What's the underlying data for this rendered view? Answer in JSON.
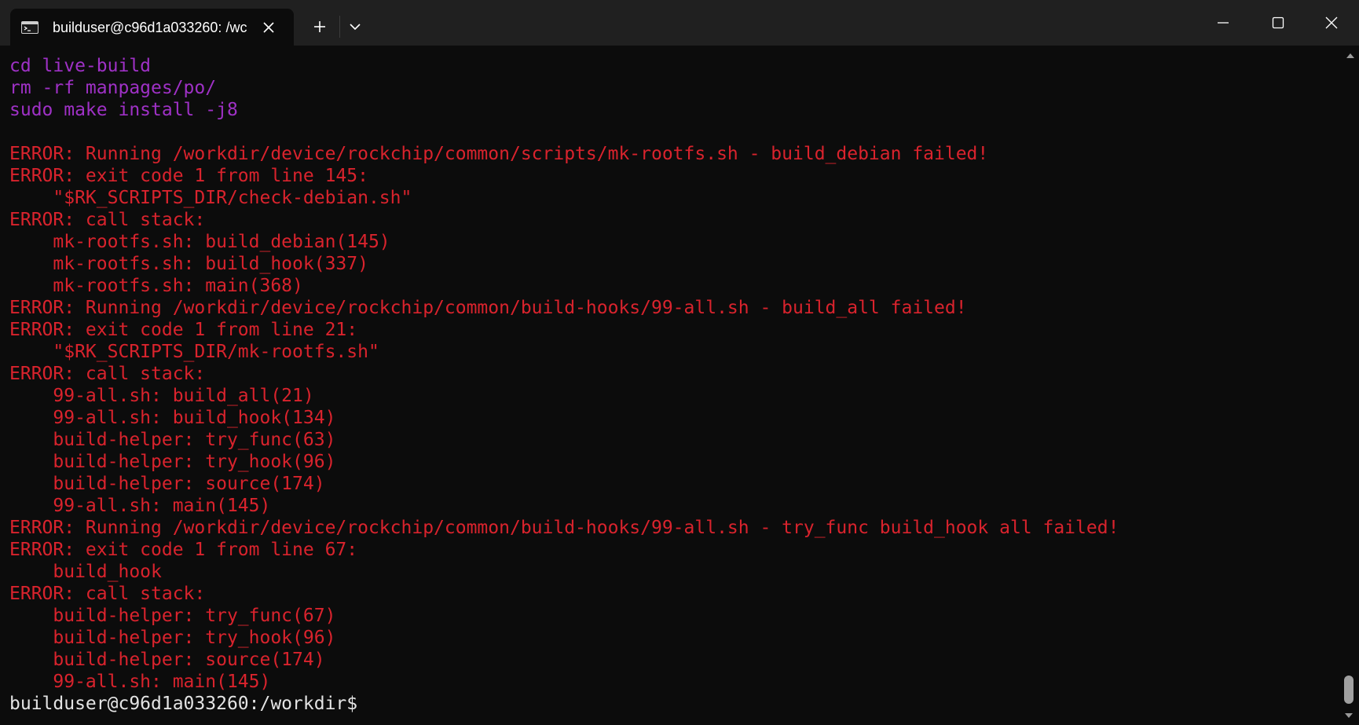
{
  "tab": {
    "title": "builduser@c96d1a033260: /wc"
  },
  "terminal": {
    "lines": [
      {
        "text": "cd live-build",
        "kind": "cmd"
      },
      {
        "text": "rm -rf manpages/po/",
        "kind": "cmd"
      },
      {
        "text": "sudo make install -j8",
        "kind": "cmd"
      },
      {
        "text": "",
        "kind": "blank"
      },
      {
        "text": "ERROR: Running /workdir/device/rockchip/common/scripts/mk-rootfs.sh - build_debian failed!",
        "kind": "err"
      },
      {
        "text": "ERROR: exit code 1 from line 145:",
        "kind": "err"
      },
      {
        "text": "    \"$RK_SCRIPTS_DIR/check-debian.sh\"",
        "kind": "err"
      },
      {
        "text": "ERROR: call stack:",
        "kind": "err"
      },
      {
        "text": "    mk-rootfs.sh: build_debian(145)",
        "kind": "err"
      },
      {
        "text": "    mk-rootfs.sh: build_hook(337)",
        "kind": "err"
      },
      {
        "text": "    mk-rootfs.sh: main(368)",
        "kind": "err"
      },
      {
        "text": "ERROR: Running /workdir/device/rockchip/common/build-hooks/99-all.sh - build_all failed!",
        "kind": "err"
      },
      {
        "text": "ERROR: exit code 1 from line 21:",
        "kind": "err"
      },
      {
        "text": "    \"$RK_SCRIPTS_DIR/mk-rootfs.sh\"",
        "kind": "err"
      },
      {
        "text": "ERROR: call stack:",
        "kind": "err"
      },
      {
        "text": "    99-all.sh: build_all(21)",
        "kind": "err"
      },
      {
        "text": "    99-all.sh: build_hook(134)",
        "kind": "err"
      },
      {
        "text": "    build-helper: try_func(63)",
        "kind": "err"
      },
      {
        "text": "    build-helper: try_hook(96)",
        "kind": "err"
      },
      {
        "text": "    build-helper: source(174)",
        "kind": "err"
      },
      {
        "text": "    99-all.sh: main(145)",
        "kind": "err"
      },
      {
        "text": "ERROR: Running /workdir/device/rockchip/common/build-hooks/99-all.sh - try_func build_hook all failed!",
        "kind": "err"
      },
      {
        "text": "ERROR: exit code 1 from line 67:",
        "kind": "err"
      },
      {
        "text": "    build_hook",
        "kind": "err"
      },
      {
        "text": "ERROR: call stack:",
        "kind": "err"
      },
      {
        "text": "    build-helper: try_func(67)",
        "kind": "err"
      },
      {
        "text": "    build-helper: try_hook(96)",
        "kind": "err"
      },
      {
        "text": "    build-helper: source(174)",
        "kind": "err"
      },
      {
        "text": "    99-all.sh: main(145)",
        "kind": "err"
      },
      {
        "text": "builduser@c96d1a033260:/workdir$",
        "kind": "prompt"
      }
    ]
  },
  "colors": {
    "background": "#0c0c0c",
    "titlebar": "#202020",
    "command": "#9f31c6",
    "error": "#d9232d",
    "prompt": "#e4e4e4"
  },
  "icons": {
    "tab": "terminal-icon",
    "close_tab": "close-icon",
    "new_tab": "plus-icon",
    "dropdown": "chevron-down-icon",
    "minimize": "minimize-icon",
    "maximize": "maximize-icon",
    "close_window": "close-icon"
  }
}
